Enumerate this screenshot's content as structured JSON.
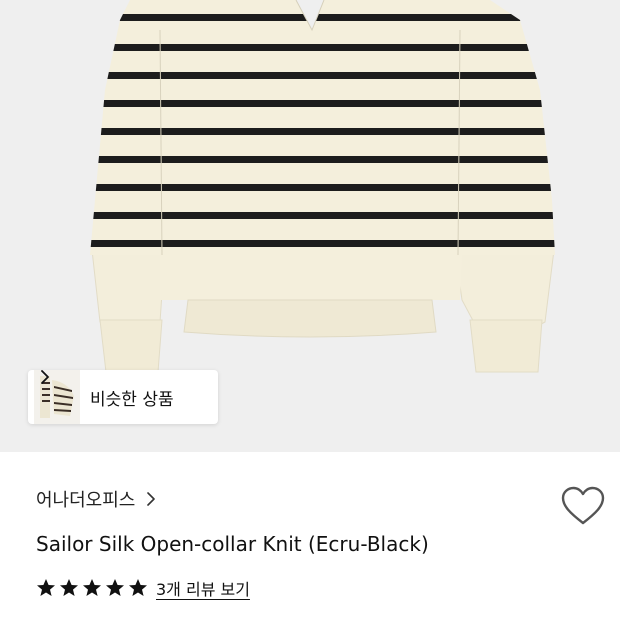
{
  "hero": {
    "image": "striped-knit-sweater-photo",
    "similar_chip": {
      "label": "비슷한 상품",
      "arrow_icon": "chevron-right-icon"
    }
  },
  "product": {
    "brand": "어나더오피스",
    "brand_arrow_icon": "chevron-right-icon",
    "title": "Sailor Silk Open-collar Knit (Ecru-Black)",
    "rating_stars": 5,
    "review_link": "3개 리뷰 보기",
    "wishlist_icon": "heart-outline-icon"
  },
  "colors": {
    "ecru": "#f4efdc",
    "stripe": "#1c1c1c",
    "background": "#efefef",
    "star": "#111111"
  }
}
